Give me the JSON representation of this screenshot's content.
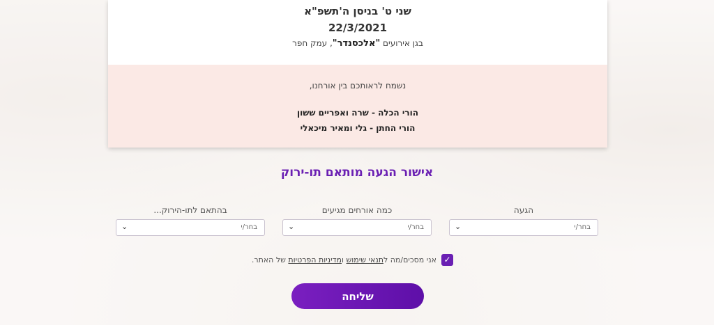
{
  "event": {
    "hebrew_date": "שני ט' בניסן ה'תשפ\"א",
    "gregorian_date": "22/3/2021",
    "venue_prefix": "בגן אירועים ",
    "venue_name": "\"אלכסנדר\"",
    "venue_suffix": ", עמק חפר"
  },
  "message": {
    "welcome": "נשמח לראותכם בין אורחנו,",
    "bride_parents": "הורי הכלה - שרה ואפריים ששון",
    "groom_parents": "הורי החתן - גלי ומאיר מיכאלי"
  },
  "form": {
    "title": "אישור הגעה מותאם תו-ירוק",
    "fields": [
      {
        "label": "הגעה",
        "value": "בחר/י"
      },
      {
        "label": "כמה אורחים מגיעים",
        "value": "בחר/י"
      },
      {
        "label": "בהתאם לתו-הירוק...",
        "value": "בחר/י"
      }
    ],
    "consent": {
      "checked": true,
      "prefix": "אני מסכים/מה ל",
      "terms_link": "תנאי שימוש",
      "middle": " ו",
      "privacy_link": "מדיניות הפרטיות",
      "suffix": " של האתר."
    },
    "submit_label": "שליחה"
  },
  "colors": {
    "accent": "#6a1fb3",
    "card_bottom": "#fbe9e5"
  },
  "icons": {
    "dropdown": "chevron-down-icon",
    "checkbox": "check-icon"
  }
}
